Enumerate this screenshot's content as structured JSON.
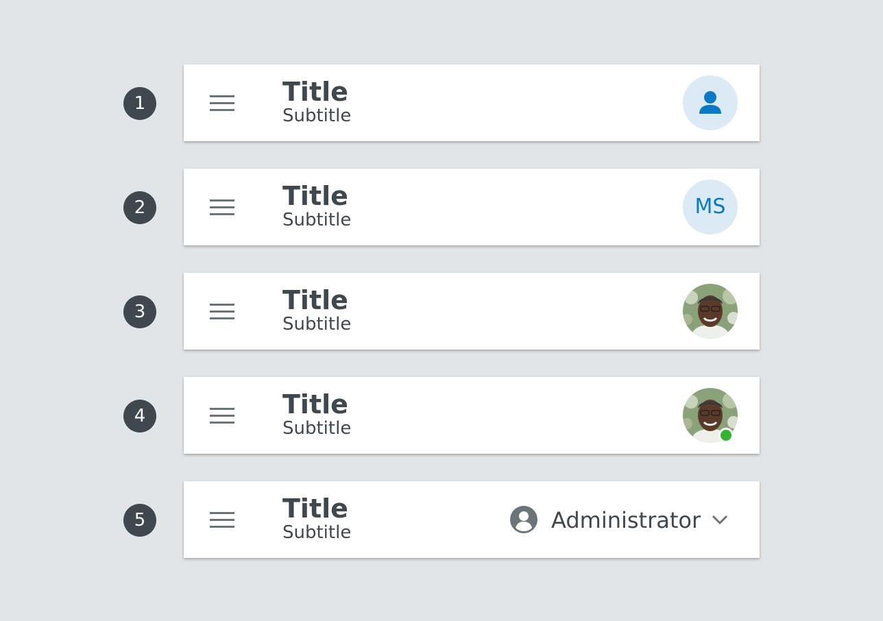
{
  "colors": {
    "background": "#e1e5e7",
    "bar": "#ffffff",
    "text": "#3f484e",
    "badge": "#3f484e",
    "accent": "#0a7ac6",
    "avatar_bg": "#dceaf5",
    "status_online": "#2fb52f"
  },
  "variants": [
    {
      "number": "1",
      "title": "Title",
      "subtitle": "Subtitle",
      "right": "person-icon-avatar"
    },
    {
      "number": "2",
      "title": "Title",
      "subtitle": "Subtitle",
      "right": "initials-avatar",
      "initials": "MS"
    },
    {
      "number": "3",
      "title": "Title",
      "subtitle": "Subtitle",
      "right": "photo-avatar"
    },
    {
      "number": "4",
      "title": "Title",
      "subtitle": "Subtitle",
      "right": "photo-avatar-with-status",
      "status": "online"
    },
    {
      "number": "5",
      "title": "Title",
      "subtitle": "Subtitle",
      "right": "user-menu",
      "user_label": "Administrator"
    }
  ],
  "icons": {
    "menu": "hamburger-menu-icon",
    "person": "person-icon",
    "account": "account-circle-icon",
    "dropdown": "chevron-down-icon"
  }
}
